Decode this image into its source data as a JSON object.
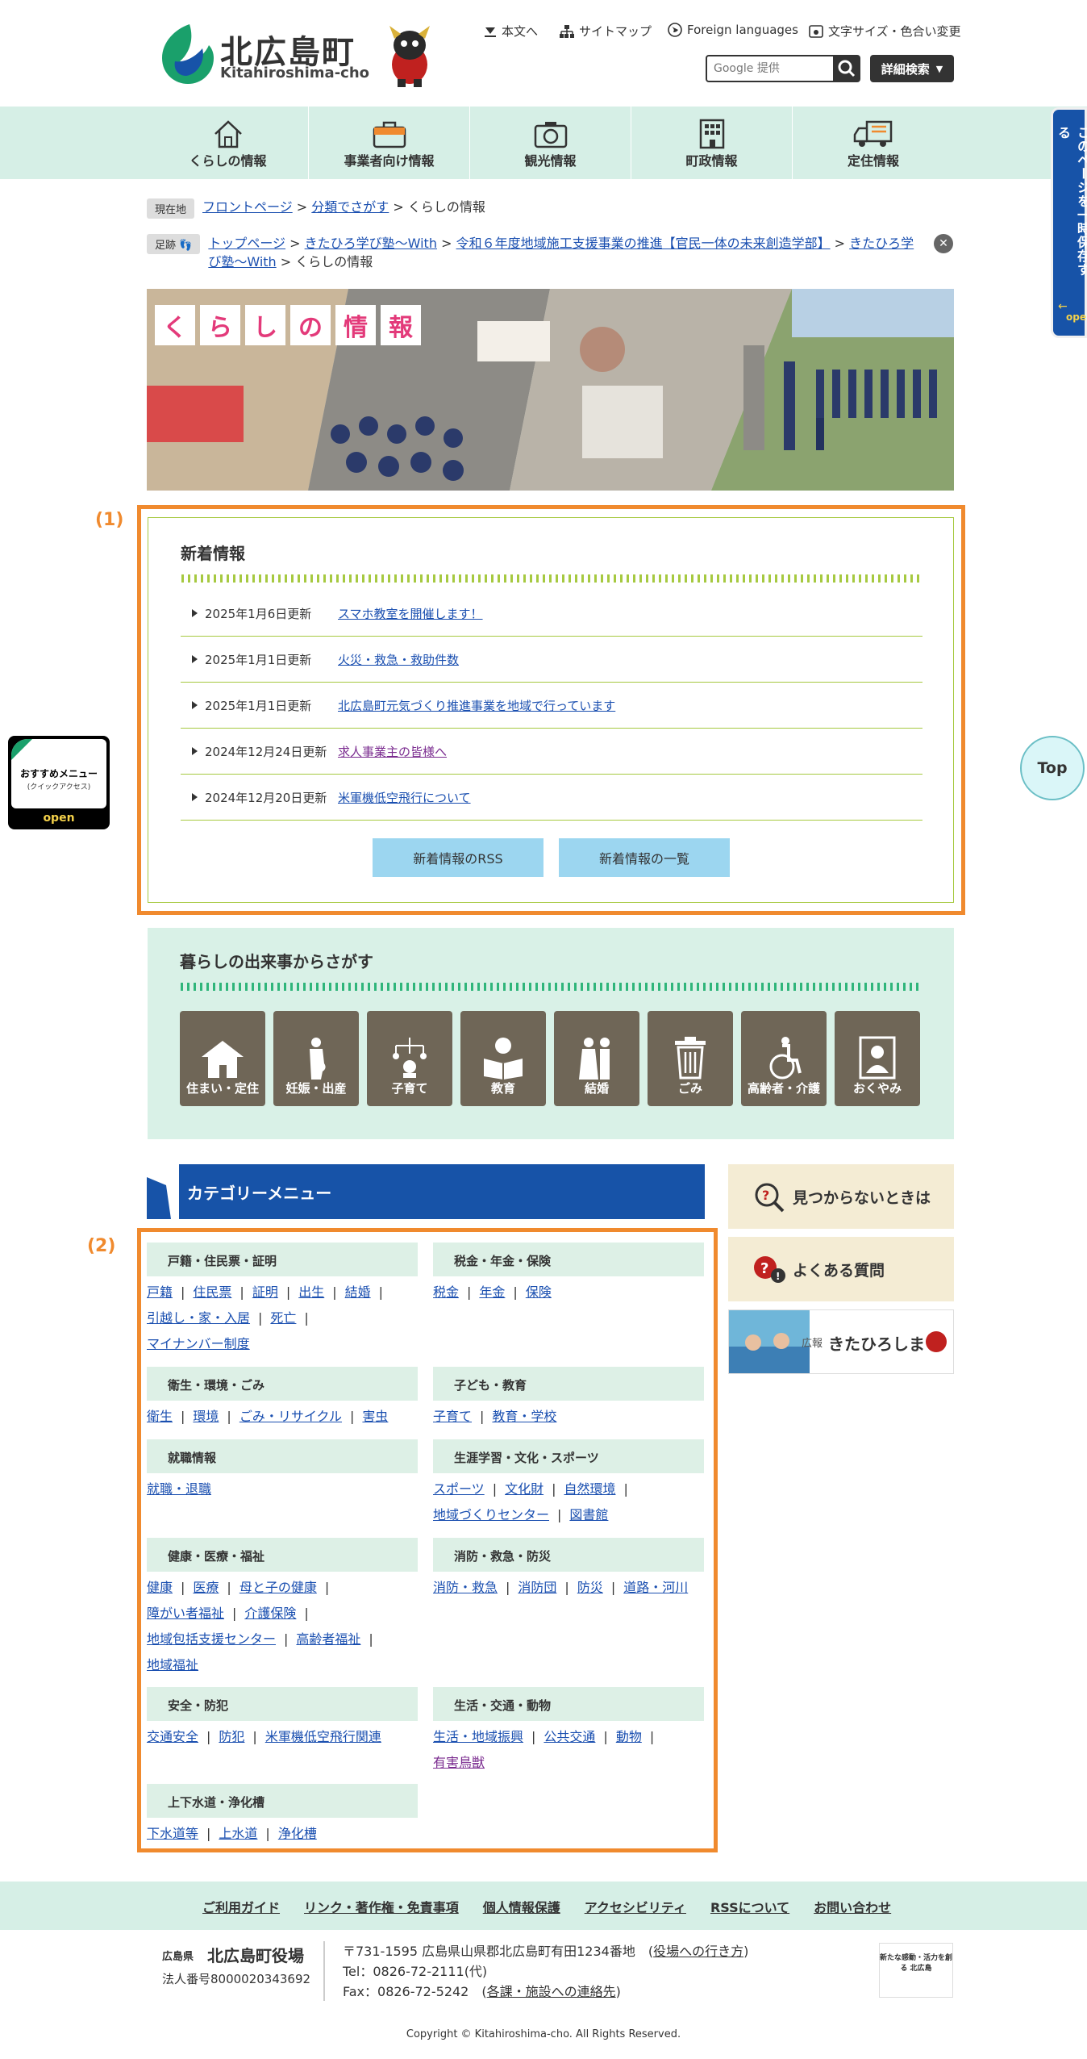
{
  "header": {
    "title": "北広島町",
    "subtitle": "Kitahiroshima-cho",
    "links": [
      {
        "label": "本文へ",
        "icon": "arrow-down-icon"
      },
      {
        "label": "サイトマップ",
        "icon": "sitemap-icon"
      },
      {
        "label": "Foreign languages",
        "icon": "globe-icon"
      },
      {
        "label": "文字サイズ・色合い変更",
        "icon": "text-size-icon"
      }
    ],
    "search_placeholder": "Google 提供",
    "advanced_search": "詳細検索"
  },
  "nav": [
    {
      "label": "くらしの情報",
      "icon": "house-icon"
    },
    {
      "label": "事業者向け情報",
      "icon": "briefcase-icon"
    },
    {
      "label": "観光情報",
      "icon": "camera-icon"
    },
    {
      "label": "町政情報",
      "icon": "building-icon"
    },
    {
      "label": "定住情報",
      "icon": "moving-truck-icon"
    }
  ],
  "side_tab": {
    "label": "このページを一時保存する",
    "open": "open"
  },
  "breadcrumb": {
    "current_tag": "現在地",
    "current": [
      "フロントページ",
      "分類でさがす",
      "くらしの情報"
    ],
    "history_tag": "足跡",
    "history": [
      "トップページ",
      "きたひろ学び塾～With",
      "令和６年度地域施工支援事業の推進【官民一体の未来創造学部】",
      "きたひろ学び塾～With",
      "くらしの情報"
    ]
  },
  "banner": {
    "title_chars": [
      "く",
      "ら",
      "し",
      "の",
      "情",
      "報"
    ]
  },
  "annotations": {
    "one": "(1)",
    "two": "(2)"
  },
  "news": {
    "title": "新着情報",
    "items": [
      {
        "date": "2025年1月6日更新",
        "link": "スマホ教室を開催します！"
      },
      {
        "date": "2025年1月1日更新",
        "link": "火災・救急・救助件数"
      },
      {
        "date": "2025年1月1日更新",
        "link": "北広島町元気づくり推進事業を地域で行っています"
      },
      {
        "date": "2024年12月24日更新",
        "link": "求人事業主の皆様へ"
      },
      {
        "date": "2024年12月20日更新",
        "link": "米軍機低空飛行について"
      }
    ],
    "rss_button": "新着情報のRSS",
    "list_button": "新着情報の一覧"
  },
  "events": {
    "title": "暮らしの出来事からさがす",
    "items": [
      {
        "label": "住まい・定住",
        "icon": "house-icon"
      },
      {
        "label": "妊娠・出産",
        "icon": "pregnancy-icon"
      },
      {
        "label": "子育て",
        "icon": "baby-mobile-icon"
      },
      {
        "label": "教育",
        "icon": "book-icon"
      },
      {
        "label": "結婚",
        "icon": "couple-icon"
      },
      {
        "label": "ごみ",
        "icon": "trash-icon"
      },
      {
        "label": "高齢者・介護",
        "icon": "wheelchair-icon"
      },
      {
        "label": "おくやみ",
        "icon": "memorial-icon"
      }
    ]
  },
  "category": {
    "title": "カテゴリーメニュー",
    "groups": [
      {
        "title": "戸籍・住民票・証明",
        "links": [
          "戸籍",
          "住民票",
          "証明",
          "出生",
          "結婚",
          "引越し・家・入居",
          "死亡",
          "マイナンバー制度"
        ]
      },
      {
        "title": "税金・年金・保険",
        "links": [
          "税金",
          "年金",
          "保険"
        ]
      },
      {
        "title": "衛生・環境・ごみ",
        "links": [
          "衛生",
          "環境",
          "ごみ・リサイクル",
          "害虫"
        ]
      },
      {
        "title": "子ども・教育",
        "links": [
          "子育て",
          "教育・学校"
        ]
      },
      {
        "title": "就職情報",
        "links": [
          "就職・退職"
        ]
      },
      {
        "title": "生涯学習・文化・スポーツ",
        "links": [
          "スポーツ",
          "文化財",
          "自然環境",
          "地域づくりセンター",
          "図書館"
        ]
      },
      {
        "title": "健康・医療・福祉",
        "links": [
          "健康",
          "医療",
          "母と子の健康",
          "障がい者福祉",
          "介護保険",
          "地域包括支援センター",
          "高齢者福祉",
          "地域福祉"
        ]
      },
      {
        "title": "消防・救急・防災",
        "links": [
          "消防・救急",
          "消防団",
          "防災",
          "道路・河川"
        ]
      },
      {
        "title": "安全・防犯",
        "links": [
          "交通安全",
          "防犯",
          "米軍機低空飛行関連"
        ]
      },
      {
        "title": "生活・交通・動物",
        "links": [
          "生活・地域振興",
          "公共交通",
          "動物",
          "有害鳥獣"
        ]
      },
      {
        "title": "上下水道・浄化槽",
        "links": [
          "下水道等",
          "上水道",
          "浄化槽"
        ]
      }
    ]
  },
  "right_menu": {
    "not_found": "見つからないときは",
    "faq": "よくある質問",
    "kouhou_small": "広報",
    "kouhou": "きたひろしま"
  },
  "floating": {
    "osusume_title": "おすすめメニュー",
    "osusume_sub": "(クイックアクセス)",
    "osusume_open": "open",
    "top": "Top"
  },
  "footer": {
    "links": [
      "ご利用ガイド",
      "リンク・著作権・免責事項",
      "個人情報保護",
      "アクセシビリティ",
      "RSSについて",
      "お問い合わせ"
    ],
    "pref": "広島県",
    "office": "北広島町役場",
    "corp_no": "法人番号8000020343692",
    "address": "〒731-1595 広島県山県郡北広島町有田1234番地",
    "access_link": "役場への行き方",
    "tel": "Tel：0826-72-2111(代)",
    "fax": "Fax：0826-72-5242",
    "contact_link": "各課・施設への連絡先",
    "badge": "新たな感動・活力を創る 北広島",
    "copyright": "Copyright © Kitahiroshima-cho. All Rights Reserved."
  },
  "colors": {
    "accent": "#1753a8",
    "nav_bg": "#d6efe6",
    "orange": "#f08a2e",
    "news_line": "#a6c940",
    "event_tile": "#6f6657"
  }
}
